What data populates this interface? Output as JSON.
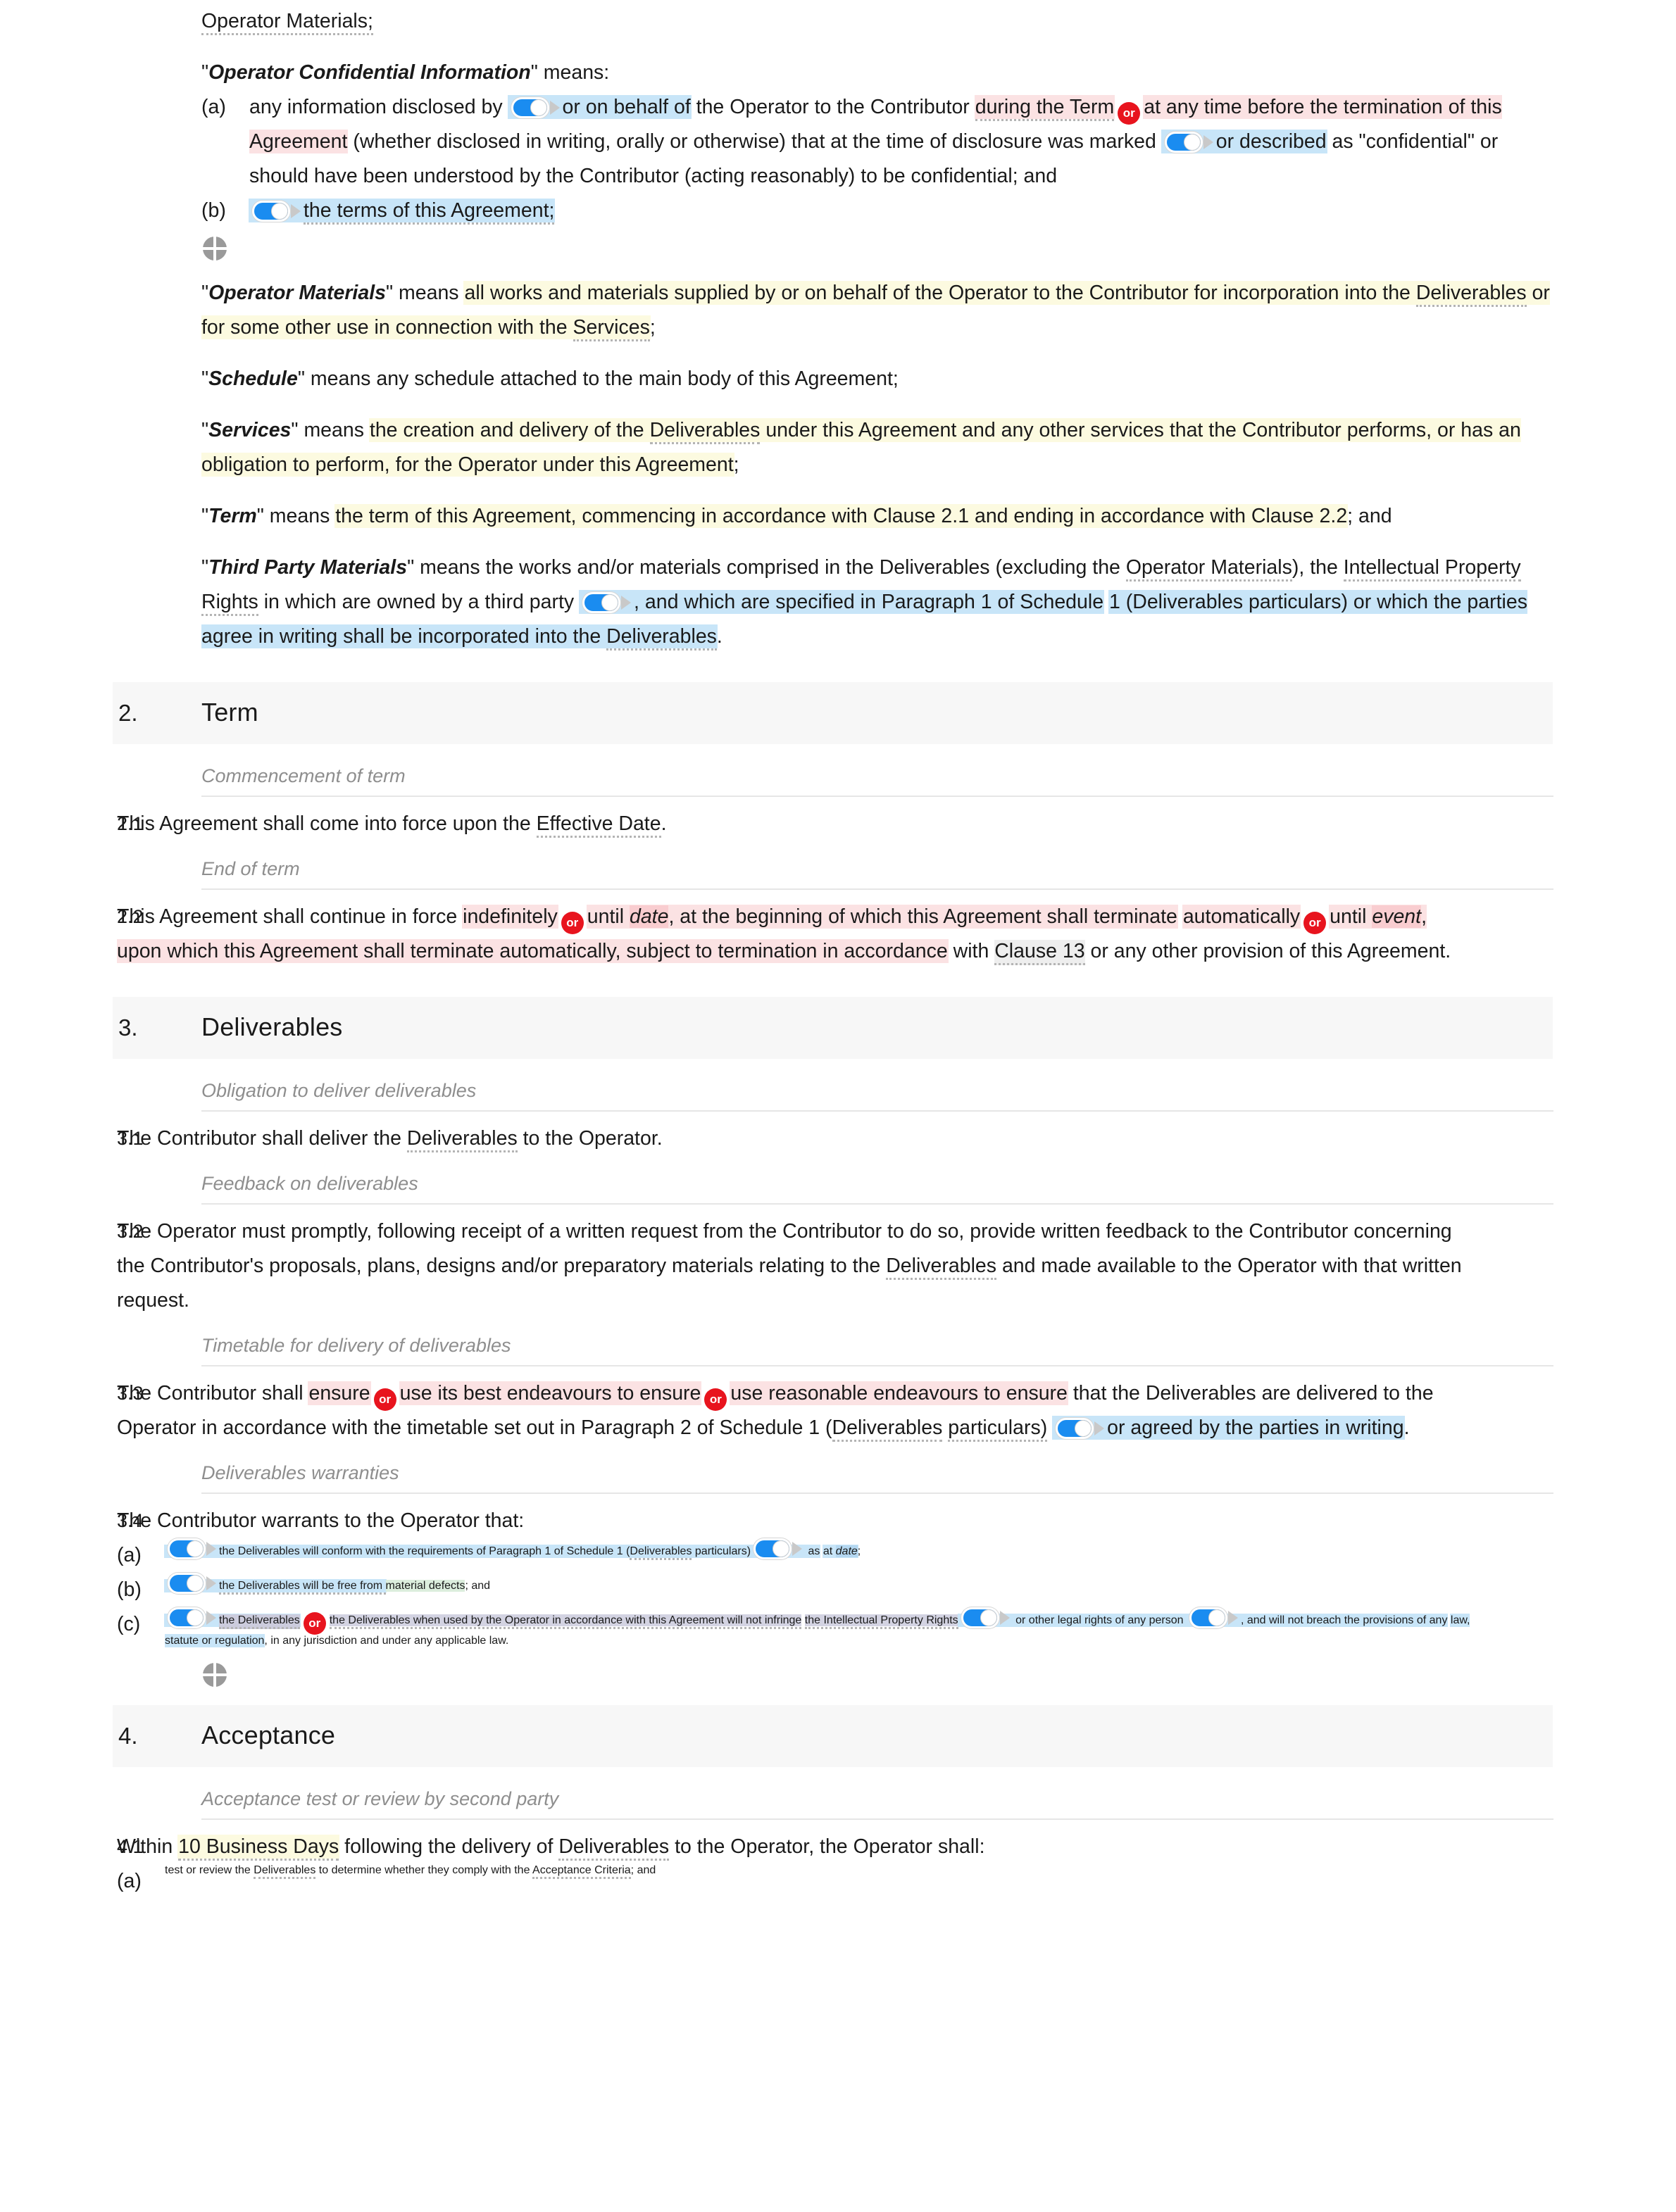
{
  "document": {
    "type": "legal-contract",
    "intro": {
      "trailing_line": "Operator Materials;"
    },
    "definitions": [
      {
        "term": "Operator Confidential Information",
        "lead": "\" means:",
        "items": [
          {
            "letter": "(a)",
            "segments": [
              {
                "t": "any information disclosed by ",
                "s": "plain"
              },
              {
                "t": "toggle",
                "s": "toggle"
              },
              {
                "t": "or on behalf of",
                "s": "hl-blue"
              },
              {
                "t": " the Operator to the Contributor ",
                "s": "plain"
              },
              {
                "t": "during the Term",
                "s": "hl-pink-dref"
              },
              {
                "t": "or",
                "s": "or-badge"
              },
              {
                "t": "at any time before the termination of this Agreement",
                "s": "hl-pink"
              },
              {
                "t": " (whether disclosed in writing, orally or otherwise) that at the time of disclosure was marked ",
                "s": "plain"
              },
              {
                "t": "toggle",
                "s": "toggle"
              },
              {
                "t": "or described",
                "s": "hl-blue"
              },
              {
                "t": " as \"confidential\" or should have been understood by the Contributor (acting reasonably) to be confidential; and",
                "s": "plain"
              }
            ]
          },
          {
            "letter": "(b)",
            "segments": [
              {
                "t": "toggle",
                "s": "toggle"
              },
              {
                "t": "the terms of this Agreement;",
                "s": "hl-blue"
              }
            ]
          }
        ]
      },
      {
        "term": "Operator Materials",
        "text_before": "\" means ",
        "highlight": "yellow",
        "body": "all works and materials supplied by or on behalf of the Operator to the Contributor for incorporation into the Deliverables or for some other use in connection with the Services",
        "tail": ";"
      },
      {
        "term": "Schedule",
        "text_before": "\" means any schedule attached to the main body of this Agreement;",
        "highlight": "none"
      },
      {
        "term": "Services",
        "text_before": "\" means ",
        "highlight": "yellow",
        "body": "the creation and delivery of the Deliverables under this Agreement and any other services that the Contributor performs, or has an obligation to perform, for the Operator under this Agreement",
        "tail": ";"
      },
      {
        "term": "Term",
        "text_before": "\" means ",
        "highlight": "yellow",
        "body": "the term of this Agreement, commencing in accordance with Clause 2.1 and ending in accordance with Clause 2.2",
        "tail": "; and"
      },
      {
        "term": "Third Party Materials",
        "text_before": "\" means the works and/or materials comprised in the Deliverables (excluding the Operator Materials), the Intellectual Property Rights in which are owned by a third party ",
        "highlight": "blue",
        "body": ", and which are specified in Paragraph 1 of Schedule 1 (Deliverables particulars) or which the parties agree in writing shall be incorporated into the Deliverables",
        "tail": "."
      }
    ],
    "sections": [
      {
        "number": "2.",
        "title": "Term",
        "groups": [
          {
            "subheading": "Commencement of term",
            "clauses": [
              {
                "number": "2.1",
                "text": "This Agreement shall come into force upon the Effective Date."
              }
            ]
          },
          {
            "subheading": "End of term",
            "clauses": [
              {
                "number": "2.2",
                "text": "This Agreement shall continue in force indefinitely or until date, at the beginning of which this Agreement shall terminate automatically or until event, upon which this Agreement shall terminate automatically, subject to termination in accordance with Clause 13 or any other provision of this Agreement.",
                "placeholders": [
                  "date",
                  "event"
                ]
              }
            ]
          }
        ]
      },
      {
        "number": "3.",
        "title": "Deliverables",
        "groups": [
          {
            "subheading": "Obligation to deliver deliverables",
            "clauses": [
              {
                "number": "3.1",
                "text": "The Contributor shall deliver the Deliverables to the Operator."
              }
            ]
          },
          {
            "subheading": "Feedback on deliverables",
            "clauses": [
              {
                "number": "3.2",
                "text": "The Operator must promptly, following receipt of a written request from the Contributor to do so, provide written feedback to the Contributor concerning the Contributor's proposals, plans, designs and/or preparatory materials relating to the Deliverables and made available to the Operator with that written request."
              }
            ]
          },
          {
            "subheading": "Timetable for delivery of deliverables",
            "clauses": [
              {
                "number": "3.3",
                "text": "The Contributor shall ensure or use its best endeavours to ensure or use reasonable endeavours to ensure that the Deliverables are delivered to the Operator in accordance with the timetable set out in Paragraph 2 of Schedule 1 (Deliverables particulars) or agreed by the parties in writing."
              }
            ]
          },
          {
            "subheading": "Deliverables warranties",
            "clauses": [
              {
                "number": "3.4",
                "text": "The Contributor warrants to the Operator that:",
                "items": [
                  {
                    "letter": "(a)",
                    "text": "the Deliverables will conform with the requirements of Paragraph 1 of Schedule 1 (Deliverables particulars) as at date;"
                  },
                  {
                    "letter": "(b)",
                    "text": "the Deliverables will be free from material defects; and"
                  },
                  {
                    "letter": "(c)",
                    "text": "the Deliverables or the Deliverables when used by the Operator in accordance with this Agreement will not infringe the Intellectual Property Rights or other legal rights of any person, and will not breach the provisions of any law, statute or regulation, in any jurisdiction and under any applicable law."
                  }
                ]
              }
            ]
          }
        ]
      },
      {
        "number": "4.",
        "title": "Acceptance",
        "groups": [
          {
            "subheading": "Acceptance test or review by second party",
            "clauses": [
              {
                "number": "4.1",
                "text": "Within 10 Business Days following the delivery of Deliverables to the Operator, the Operator shall:",
                "items": [
                  {
                    "letter": "(a)",
                    "text": "test or review the Deliverables to determine whether they comply with the Acceptance Criteria; and"
                  }
                ]
              }
            ]
          }
        ]
      }
    ],
    "fragments": {
      "f_op_materials_trailing": "Operator Materials;",
      "f_means": "\" means:",
      "a_1": "any information disclosed by ",
      "a_2": "or on behalf of",
      "a_3": " the Operator to the Contributor ",
      "a_4": "during the Term",
      "a_5": "at any time before the termination of this Agreement",
      "a_6": " (whether disclosed in writing, orally or otherwise) that at the time of disclosure was",
      "a_7": "marked ",
      "a_8": "or described",
      "a_9": " as \"confidential\" or should have been understood by the Contributor (acting reasonably) to be",
      "a_10": "confidential; and",
      "b_1": "the terms of this Agreement;",
      "om_quote_open": "\"",
      "om_term": "Operator Materials",
      "om_after": "\" means ",
      "om_body_1": "all works and materials supplied by or on behalf of the Operator to the Contributor for",
      "om_body_2a": "incorporation into the ",
      "om_body_2b": "Deliverables",
      "om_body_2c": " or for some other use in connection with the ",
      "om_body_2d": "Services",
      "om_tail": ";",
      "sch_term": "Schedule",
      "sch_after": "\" means any schedule attached to the main body of this Agreement;",
      "svc_term": "Services",
      "svc_after": "\" means ",
      "svc_1a": "the creation and delivery of the ",
      "svc_1b": "Deliverables",
      "svc_1c": " under this Agreement and any other services that",
      "svc_2": "the Contributor performs, or has an obligation to perform, for the Operator under this Agreement",
      "svc_tail": ";",
      "trm_term": "Term",
      "trm_after": "\" means ",
      "trm_1": "the term of this Agreement, commencing in accordance with Clause 2.1 and ending in accordance with Clause",
      "trm_2": "2.2",
      "trm_tail": "; and",
      "tpm_term": "Third Party Materials",
      "tpm_1": "\" means the works and/or materials comprised in the Deliverables (excluding the ",
      "tpm_1b": "Operator Materials",
      "tpm_1c": "),",
      "tpm_2a": "the ",
      "tpm_2b": "Intellectual Property Rights",
      "tpm_2c": " in which are owned by a third party ",
      "tpm_3": ", and which are specified in Paragraph 1 of Schedule",
      "tpm_4a": "1 (Deliverables particulars) or which the parties agree in writing shall be incorporated into the ",
      "tpm_4b": "Deliverables",
      "tpm_tail": ".",
      "c21": "This Agreement shall come into force upon the ",
      "c21b": "Effective Date",
      "c21c": ".",
      "c22_1": "This Agreement shall continue in force ",
      "c22_2": "indefinitely",
      "c22_3": "until ",
      "c22_4": "date",
      "c22_5": ", at the beginning of which this Agreement shall terminate",
      "c22_6": "automatically",
      "c22_7": "until ",
      "c22_8": "event",
      "c22_9": ", upon which this Agreement shall terminate automatically, subject to termination in accordance",
      "c22_10a": "with ",
      "c22_10b": "Clause 13",
      "c22_10c": " or any other provision of this Agreement.",
      "c31a": "The Contributor shall deliver the ",
      "c31b": "Deliverables",
      "c31c": " to the Operator.",
      "c32_1": "The Operator must promptly, following receipt of a written request from the Contributor to do so, provide written feedback to",
      "c32_2": "the Contributor concerning the Contributor's proposals, plans, designs and/or preparatory materials relating to the",
      "c32_3a": "Deliverables",
      "c32_3b": " and made available to the Operator with that written request.",
      "c33_1": "The Contributor shall ",
      "c33_2": "ensure",
      "c33_3": "use its best endeavours to ensure",
      "c33_4": "use reasonable endeavours to ensure",
      "c33_5": " that the",
      "c33_6": "Deliverables are delivered to the Operator in accordance with the timetable set out in Paragraph 2 of Schedule 1 (",
      "c33_6b": "Deliverables",
      "c33_7": "particulars)",
      "c33_8": "or agreed by the parties in writing",
      "c33_9": ".",
      "c34_lead": "The Contributor warrants to the Operator that:",
      "c34a_1": "the Deliverables will conform with the requirements of Paragraph 1 of Schedule 1 (",
      "c34a_1b": "Deliverables",
      "c34a_1c": " particulars)",
      "c34a_2": "as",
      "c34a_3": "at ",
      "c34a_4": "date",
      "c34a_5": ";",
      "c34b_1": "the Deliverables will be free from ",
      "c34b_2": "material defects",
      "c34b_3": "; and",
      "c34c_1": "the Deliverables",
      "c34c_2": "the Deliverables when used by the Operator in accordance with this Agreement will not infringe",
      "c34c_3": "the Intellectual Property Rights",
      "c34c_4": "or other legal rights of any person",
      "c34c_5": ", and will not breach the provisions of any",
      "c34c_6": "law, statute or regulation",
      "c34c_7": ", in any jurisdiction and under any applicable law.",
      "c41_1": "Within ",
      "c41_2": "10 Business Days",
      "c41_3": " following the delivery of ",
      "c41_3b": "Deliverables",
      "c41_4": " to the Operator, the Operator shall:",
      "c41a_1": "test or review the ",
      "c41a_1b": "Deliverables",
      "c41a_2": " to determine whether they comply with the ",
      "c41a_2b": "Acceptance Criteria",
      "c41a_3": "; and",
      "or_label": "or",
      "sub_commencement": "Commencement of term",
      "sub_end": "End of term",
      "sub_obligation": "Obligation to deliver deliverables",
      "sub_feedback": "Feedback on deliverables",
      "sub_timetable": "Timetable for delivery of deliverables",
      "sub_warranties": "Deliverables warranties",
      "sub_acceptance": "Acceptance test or review by second party",
      "sec2_num": "2.",
      "sec2_title": "Term",
      "sec3_num": "3.",
      "sec3_title": "Deliverables",
      "sec4_num": "4.",
      "sec4_title": "Acceptance",
      "n21": "2.1",
      "n22": "2.2",
      "n31": "3.1",
      "n32": "3.2",
      "n33": "3.3",
      "n34": "3.4",
      "n41": "4.1",
      "la": "(a)",
      "lb": "(b)",
      "lc": "(c)"
    },
    "colors": {
      "toggle_on": "#1a8cf0",
      "or_badge": "#e8141e",
      "highlight_yellow": "#fcfae0",
      "highlight_blue": "#c8e5f8",
      "highlight_pink": "#fbe2e3",
      "highlight_green": "#dceedd",
      "section_band": "#f7f7f7",
      "subheading_text": "#8e8e8e"
    }
  }
}
